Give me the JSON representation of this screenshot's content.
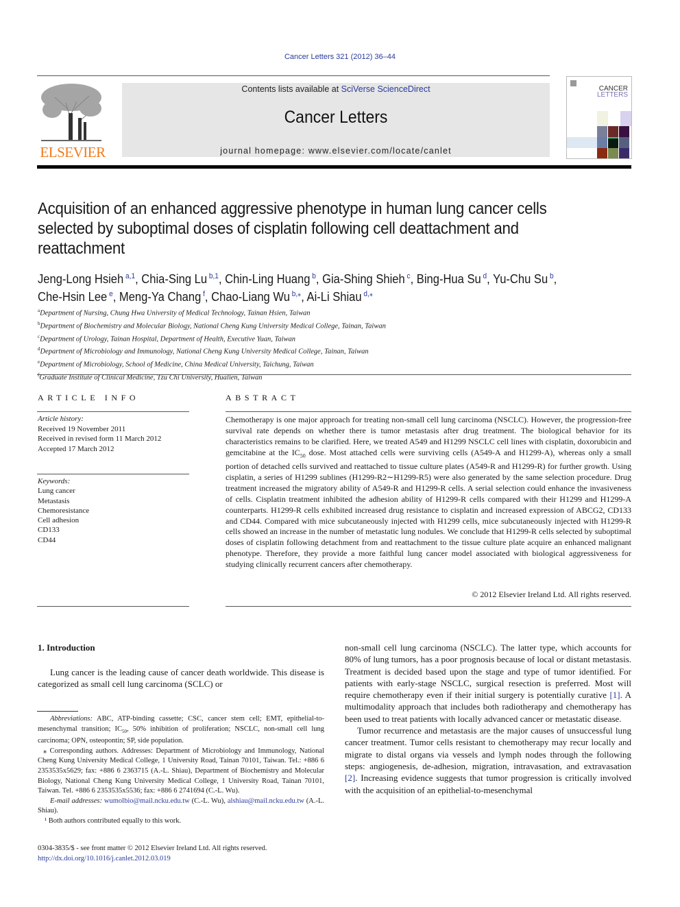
{
  "journal_ref": "Cancer Letters 321 (2012) 36–44",
  "header": {
    "contents_prefix": "Contents lists available at ",
    "contents_link": "SciVerse ScienceDirect",
    "journal_title": "Cancer Letters",
    "homepage_label": "journal homepage: ",
    "homepage_url": "www.elsevier.com/locate/canlet",
    "publisher_logo_text": "ELSEVIER",
    "cover_title_line1": "CANCER",
    "cover_title_line2": "LETTERS"
  },
  "article": {
    "title": "Acquisition of an enhanced aggressive phenotype in human lung cancer cells selected by suboptimal doses of cisplatin following cell deattachment and reattachment",
    "authors": [
      {
        "name": "Jeng-Long Hsieh",
        "sup": "a,1"
      },
      {
        "name": "Chia-Sing Lu",
        "sup": "b,1"
      },
      {
        "name": "Chin-Ling Huang",
        "sup": "b"
      },
      {
        "name": "Gia-Shing Shieh",
        "sup": "c"
      },
      {
        "name": "Bing-Hua Su",
        "sup": "d"
      },
      {
        "name": "Yu-Chu Su",
        "sup": "b"
      },
      {
        "name": "Che-Hsin Lee",
        "sup": "e"
      },
      {
        "name": "Meng-Ya Chang",
        "sup": "f"
      },
      {
        "name": "Chao-Liang Wu",
        "sup": "b,⁎"
      },
      {
        "name": "Ai-Li Shiau",
        "sup": "d,⁎"
      }
    ],
    "affiliations": [
      {
        "key": "a",
        "text": "Department of Nursing, Chung Hwa University of Medical Technology, Tainan Hsien, Taiwan"
      },
      {
        "key": "b",
        "text": "Department of Biochemistry and Molecular Biology, National Cheng Kung University Medical College, Tainan, Taiwan"
      },
      {
        "key": "c",
        "text": "Department of Urology, Tainan Hospital, Department of Health, Executive Yuan, Taiwan"
      },
      {
        "key": "d",
        "text": "Department of Microbiology and Immunology, National Cheng Kung University Medical College, Tainan, Taiwan"
      },
      {
        "key": "e",
        "text": "Department of Microbiology, School of Medicine, China Medical University, Taichung, Taiwan"
      },
      {
        "key": "f",
        "text": "Graduate Institute of Clinical Medicine, Tzu Chi University, Hualien, Taiwan"
      }
    ]
  },
  "article_info": {
    "heading": "ARTICLE INFO",
    "history_label": "Article history:",
    "history": [
      "Received 19 November 2011",
      "Received in revised form 11 March 2012",
      "Accepted 17 March 2012"
    ],
    "keywords_label": "Keywords:",
    "keywords": [
      "Lung cancer",
      "Metastasis",
      "Chemoresistance",
      "Cell adhesion",
      "CD133",
      "CD44"
    ]
  },
  "abstract": {
    "heading": "ABSTRACT",
    "text_part1": "Chemotherapy is one major approach for treating non-small cell lung carcinoma (NSCLC). However, the progression-free survival rate depends on whether there is tumor metastasis after drug treatment. The biological behavior for its characteristics remains to be clarified. Here, we treated A549 and H1299 NSCLC cell lines with cisplatin, doxorubicin and gemcitabine at the IC",
    "text_sub": "50",
    "text_part2": " dose. Most attached cells were surviving cells (A549-A and H1299-A), whereas only a small portion of detached cells survived and reattached to tissue culture plates (A549-R and H1299-R) for further growth. Using cisplatin, a series of H1299 sublines (H1299-R2∼H1299-R5) were also generated by the same selection procedure. Drug treatment increased the migratory ability of A549-R and H1299-R cells. A serial selection could enhance the invasiveness of cells. Cisplatin treatment inhibited the adhesion ability of H1299-R cells compared with their H1299 and H1299-A counterparts. H1299-R cells exhibited increased drug resistance to cisplatin and increased expression of ABCG2, CD133 and CD44. Compared with mice subcutaneously injected with H1299 cells, mice subcutaneously injected with H1299-R cells showed an increase in the number of metastatic lung nodules. We conclude that H1299-R cells selected by suboptimal doses of cisplatin following detachment from and reattachment to the tissue culture plate acquire an enhanced malignant phenotype. Therefore, they provide a more faithful lung cancer model associated with biological aggressiveness for studying clinically recurrent cancers after chemotherapy.",
    "copyright": "© 2012 Elsevier Ireland Ltd. All rights reserved."
  },
  "intro": {
    "heading": "1. Introduction",
    "p1": "Lung cancer is the leading cause of cancer death worldwide. This disease is categorized as small cell lung carcinoma (SCLC) or",
    "right_p1_a": "non-small cell lung carcinoma (NSCLC). The latter type, which accounts for 80% of lung tumors, has a poor prognosis because of local or distant metastasis. Treatment is decided based upon the stage and type of tumor identified. For patients with early-stage NSCLC, surgical resection is preferred. Most will require chemotherapy even if their initial surgery is potentially curative ",
    "ref1": "[1]",
    "right_p1_b": ". A multimodality approach that includes both radiotherapy and chemotherapy has been used to treat patients with locally advanced cancer or metastatic disease.",
    "right_p2_a": "Tumor recurrence and metastasis are the major causes of unsuccessful lung cancer treatment. Tumor cells resistant to chemotherapy may recur locally and migrate to distal organs via vessels and lymph nodes through the following steps: angiogenesis, de-adhesion, migration, intravasation, and extravasation ",
    "ref2": "[2]",
    "right_p2_b": ". Increasing evidence suggests that tumor progression is critically involved with the acquisition of an epithelial-to-mesenchymal"
  },
  "footnotes": {
    "abbrev_label": "Abbreviations:",
    "abbrev_a": " ABC, ATP-binding cassette; CSC, cancer stem cell; EMT, epithelial-to-mesenchymal transition; IC",
    "abbrev_sub": "50",
    "abbrev_b": ", 50% inhibition of proliferation; NSCLC, non-small cell lung carcinoma; OPN, osteopontin; SP, side population.",
    "corresponding": "⁎ Corresponding authors. Addresses: Department of Microbiology and Immunology, National Cheng Kung University Medical College, 1 University Road, Tainan 70101, Taiwan. Tel.: +886 6 2353535x5629; fax: +886 6 2363715 (A.-L. Shiau), Department of Biochemistry and Molecular Biology, National Cheng Kung University Medical College, 1 University Road, Tainan 70101, Taiwan. Tel. +886 6 2353535x5536; fax: +886 6 2741694 (C.-L. Wu).",
    "email_label": "E-mail addresses:",
    "email1": "wumolbio@mail.ncku.edu.tw",
    "email1_owner": " (C.-L. Wu), ",
    "email2": "alshiau@mail.ncku.edu.tw",
    "email2_owner": " (A.-L. Shiau).",
    "equal": "¹ Both authors contributed equally to this work.",
    "front_matter": "0304-3835/$ - see front matter © 2012 Elsevier Ireland Ltd. All rights reserved.",
    "doi": "http://dx.doi.org/10.1016/j.canlet.2012.03.019"
  }
}
